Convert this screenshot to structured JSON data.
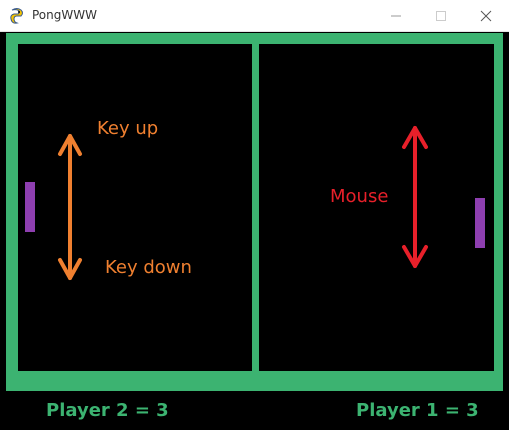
{
  "window": {
    "title": "PongWWW",
    "app_icon": "pygame-snake-icon",
    "controls": [
      "minimize-icon",
      "maximize-icon",
      "close-icon"
    ]
  },
  "game": {
    "colors": {
      "border": "#3cb371",
      "background": "#000000",
      "paddle": "#8e3fb0",
      "annotation_keys": "#f08030",
      "annotation_mouse": "#e8202a",
      "score_text": "#3cb371"
    },
    "annotations": {
      "key_up": "Key up",
      "key_down": "Key down",
      "mouse": "Mouse"
    },
    "scores": {
      "player2": "Player 2 = 3",
      "player1": "Player 1 = 3"
    }
  }
}
